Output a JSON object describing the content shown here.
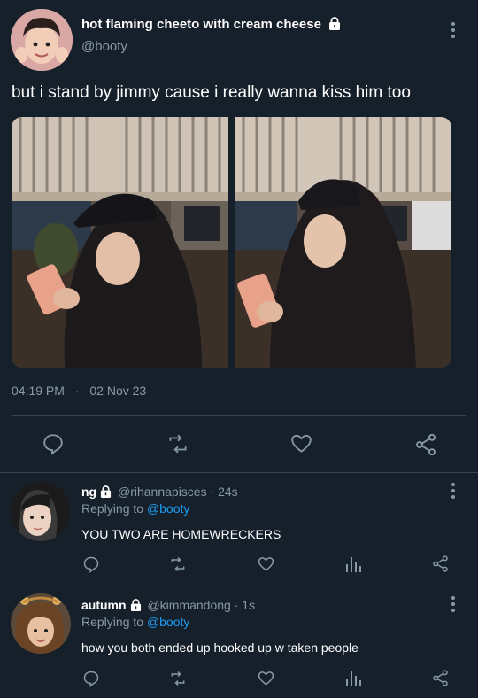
{
  "main_tweet": {
    "display_name": "hot flaming cheeto with cream cheese",
    "handle": "@booty",
    "text": "but i stand by jimmy cause i really wanna kiss him too",
    "time": "04:19 PM",
    "separator": "·",
    "date": "02 Nov 23",
    "protected": true
  },
  "replies": [
    {
      "display_name": "ng",
      "handle": "@rihannapisces",
      "dot": "·",
      "age": "24s",
      "replying_prefix": "Replying to",
      "replying_to": "@booty",
      "text": "YOU TWO ARE HOMEWRECKERS",
      "protected": true
    },
    {
      "display_name": "autumn",
      "handle": "@kimmandong",
      "dot": "·",
      "age": "1s",
      "replying_prefix": "Replying to",
      "replying_to": "@booty",
      "text": "how you both ended up hooked up w taken people",
      "protected": true
    }
  ],
  "colors": {
    "background": "#15202b",
    "muted": "#8899a6",
    "link": "#1d9bf0",
    "divider": "#38444d"
  },
  "icons": [
    "more-icon",
    "lock-icon",
    "reply-icon",
    "retweet-icon",
    "like-icon",
    "share-icon",
    "analytics-icon"
  ]
}
